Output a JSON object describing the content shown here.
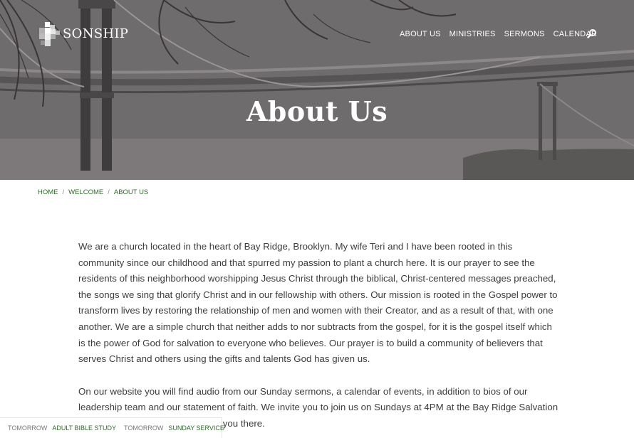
{
  "colors": {
    "accent_green": "#2f6b2a",
    "body_text": "#3d3d3d",
    "hero_overlay": "#6b6869",
    "white": "#ffffff"
  },
  "header": {
    "logo_text": "SONSHIP",
    "logo_icon": "pixel-cross-icon",
    "nav": [
      {
        "label": "ABOUT US"
      },
      {
        "label": "MINISTRIES"
      },
      {
        "label": "SERMONS"
      },
      {
        "label": "CALENDAR"
      }
    ],
    "search_icon": "search-icon"
  },
  "hero": {
    "title": "About Us",
    "background": "bridge-photo"
  },
  "breadcrumb": {
    "items": [
      {
        "label": "HOME"
      },
      {
        "label": "WELCOME"
      },
      {
        "label": "ABOUT US"
      }
    ],
    "separator": "/"
  },
  "content": {
    "paragraphs": [
      "We are a church located in the heart of Bay Ridge, Brooklyn.  My wife Teri and I have been rooted in this community since our childhood and that spurred my passion to plant a church here. It is our prayer to see the residents of this neighborhood worshipping Jesus Christ through the biblical, Christ-centered messages preached, the songs we sing that glorify Christ and in our fellowship with others. Our mission is rooted in the Gospel power to transform lives by restoring the relationship of men and women with their Creator, and as a result of that, with one another. We are a simple church that neither adds to nor subtracts from the gospel, for it is the gospel itself which is the power of God for salvation to everyone who believes. Our prayer is to build a community of believers that serves Christ and others using the gifts and talents God has given us.",
      "On our website you will find audio from our Sunday sermons, a calendar of events, in addition to bios of our leadership team and our statement of faith. We invite you to join us on Sundays at 4PM at the Bay Ridge Salvation Army. We look forward to meeting you there."
    ]
  },
  "events_bar": {
    "events": [
      {
        "when": "TOMORROW",
        "title": "ADULT BIBLE STUDY"
      },
      {
        "when": "TOMORROW",
        "title": "SUNDAY SERVICE"
      }
    ]
  }
}
